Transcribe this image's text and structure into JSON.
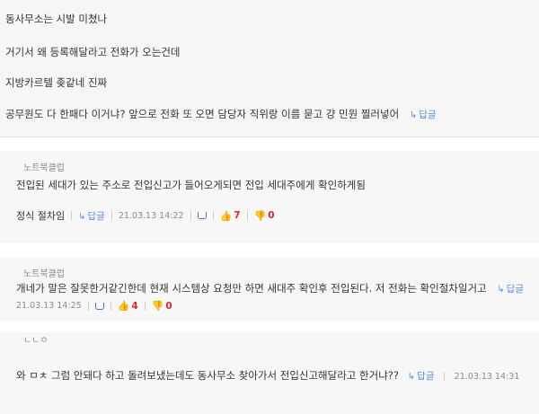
{
  "top": {
    "lines": [
      "동사무소는 시발 미쳤나",
      "거기서 왜 등록해달라고 전화가 오는건데",
      "지방카르텔 좆같네 진짜",
      "공무원도 다 한패다 이거냐? 앞으로 전화 또 오면 담당자 직위랑 이름 묻고 걍 민원 찔러넣어"
    ],
    "reply_label": "답글"
  },
  "comments": [
    {
      "author": "노트북클럽",
      "body": "전입된 세대가 있는 주소로 전입신고가 들어오게되면 전입 세대주에게 확인하게됨",
      "body2": "정식 절차임",
      "reply_label": "답글",
      "date": "21.03.13 14:22",
      "up": "7",
      "down": "0"
    },
    {
      "author": "노트북클럽",
      "body": "개네가 말은 잘못한거같긴한데 현재 시스템상 요청만 하면 새대주 확인후 전입된다. 저 전화는 확인절차일거고",
      "reply_label": "답글",
      "date": "21.03.13 14:25",
      "up": "4",
      "down": "0"
    },
    {
      "author": "ㄴㄴㅇ",
      "body": "와 ㅁㅊ 그럼 안돼다 하고 돌려보냈는데도 동사무소 찾아가서 전입신고해달라고 한거냐??",
      "reply_label": "답글",
      "date": "21.03.13 14:31"
    }
  ]
}
